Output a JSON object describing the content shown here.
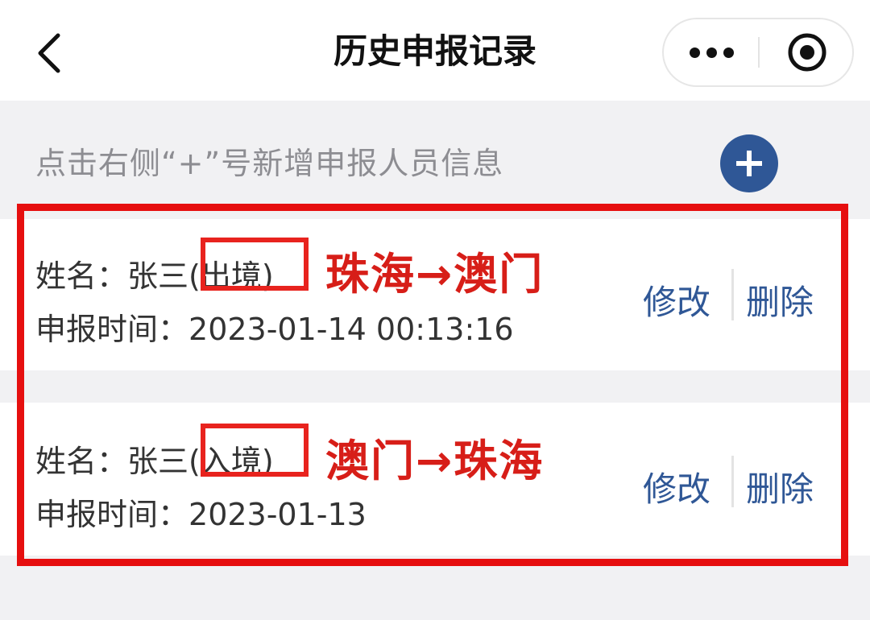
{
  "nav": {
    "title": "历史申报记录",
    "back_icon": "chevron-left-icon",
    "more_icon": "more-dots-icon",
    "close_icon": "target-circle-icon"
  },
  "hint": {
    "text": "点击右侧“+”号新增申报人员信息",
    "add_icon": "plus-circle-icon",
    "add_color": "#2f5796"
  },
  "records": [
    {
      "name_prefix": "姓名：张三",
      "direction": "(出境)",
      "route": "珠海→澳门",
      "time_label": "申报时间：",
      "time_value": "2023-01-14 00:13:16",
      "edit_label": "修改",
      "delete_label": "删除"
    },
    {
      "name_prefix": "姓名：张三",
      "direction": "(入境)",
      "route": "澳门→珠海",
      "time_label": "申报时间：",
      "time_value": "2023-01-13",
      "edit_label": "修改",
      "delete_label": "删除"
    }
  ],
  "colors": {
    "accent": "#2f5796",
    "annotation_red": "#e60f0f",
    "route_red": "#d71e18"
  }
}
